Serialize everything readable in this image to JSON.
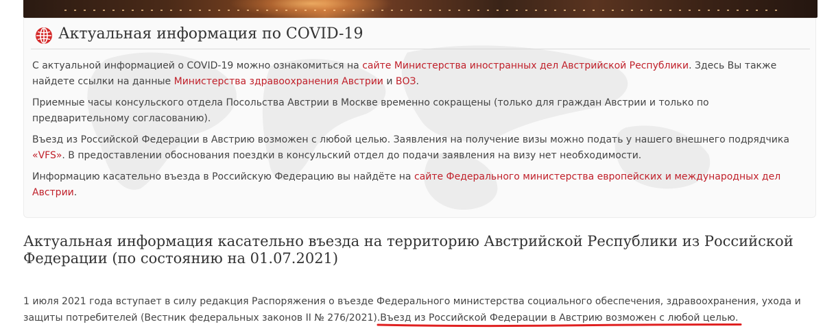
{
  "covid_box": {
    "title": "Актуальная информация по COVID-19",
    "p1": {
      "text1": "С актуальной информацией о COVID-19 можно ознакомиться на ",
      "link1": "сайте Министерства иностранных дел Австрийской Республики",
      "text2": ". Здесь Вы также найдете ссылки на данные ",
      "link2": "Министерства здравоохранения Австрии",
      "text3": " и ",
      "link3": "ВОЗ",
      "text4": "."
    },
    "p2": "Приемные часы консульского отдела Посольства Австрии в Москве временно сокращены (только для граждан Австрии и только по предварительному согласованию).",
    "p3": {
      "text1": "Въезд из Российской Федерации в Австрию возможен с любой целью. Заявления на получение визы можно подать у нашего внешнего подрядчика ",
      "link1": "«VFS»",
      "text2": ". В предоставлении обоснования поездки в консульский отдел до подачи заявления на визу нет необходимости."
    },
    "p4": {
      "text1": " Информацию касательно въезда в Российскую Федерацию вы найдёте на ",
      "link1": "сайте Федерального министерства европейских и международных дел Австрии",
      "text2": "."
    }
  },
  "main": {
    "title": "Актуальная информация касательно въезда на территорию Австрийской Республики из Российской Федерации (по состоянию на 01.07.2021)",
    "text1": "1 июля 2021 года вступает в силу редакция Распоряжения о въезде Федерального министерства социального обеспечения, здравоохранения, ухода и защиты потребителей (Вестник федеральных законов II № 276/2021).",
    "highlight": "Въезд из Российской Федерации в Австрию возможен с любой целью",
    "text2": "."
  },
  "colors": {
    "link": "#c0202a",
    "globe": "#d42a2a",
    "underline": "#e02020"
  },
  "icons": {
    "header": "globe-icon"
  }
}
